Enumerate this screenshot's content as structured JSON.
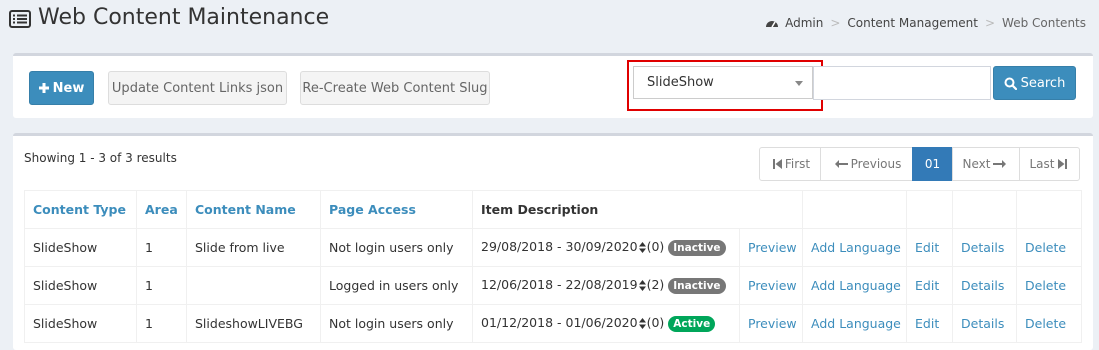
{
  "header": {
    "title": "Web Content Maintenance",
    "title_icon": "list-alt-icon",
    "breadcrumb": {
      "icon": "dashboard-icon",
      "items": [
        "Admin",
        "Content Management",
        "Web Contents"
      ],
      "separator": ">"
    }
  },
  "toolbar": {
    "new_label": "New",
    "update_label": "Update Content Links json",
    "recreate_label": "Re-Create Web Content Slug",
    "select_value": "SlideShow",
    "search_value": "",
    "search_placeholder": "",
    "search_label": "Search"
  },
  "results": {
    "summary": "Showing 1 - 3 of 3 results"
  },
  "pager": {
    "first": "First",
    "previous": "Previous",
    "current": "01",
    "next": "Next",
    "last": "Last"
  },
  "table": {
    "headers": [
      "Content Type",
      "Area",
      "Content Name",
      "Page Access",
      "Item Description",
      "",
      "",
      "",
      "",
      ""
    ],
    "rows": [
      {
        "type": "SlideShow",
        "area": "1",
        "name": "Slide from live",
        "access": "Not login users only",
        "dates": "29/08/2018 - 30/09/2020",
        "count": "(0)",
        "status": "Inactive",
        "preview": "Preview",
        "add_language": "Add Language",
        "edit": "Edit",
        "details": "Details",
        "delete": "Delete"
      },
      {
        "type": "SlideShow",
        "area": "1",
        "name": "",
        "access": "Logged in users only",
        "dates": "12/06/2018 - 22/08/2019",
        "count": "(2)",
        "status": "Inactive",
        "preview": "Preview",
        "add_language": "Add Language",
        "edit": "Edit",
        "details": "Details",
        "delete": "Delete"
      },
      {
        "type": "SlideShow",
        "area": "1",
        "name": "SlideshowLIVEBG",
        "access": "Not login users only",
        "dates": "01/12/2018 - 01/06/2020",
        "count": "(0)",
        "status": "Active",
        "preview": "Preview",
        "add_language": "Add Language",
        "edit": "Edit",
        "details": "Details",
        "delete": "Delete"
      }
    ]
  },
  "colors": {
    "primary": "#3c8dbc",
    "active_badge": "#00a65a",
    "inactive_badge": "#777777",
    "highlight_border": "#e00000"
  }
}
